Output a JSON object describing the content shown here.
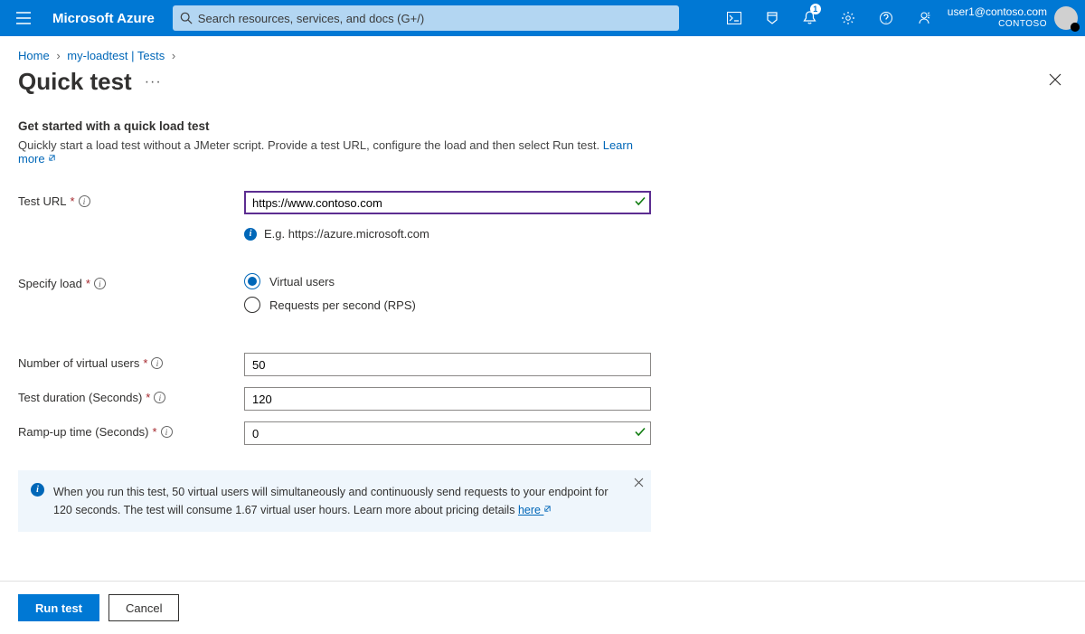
{
  "header": {
    "brand": "Microsoft Azure",
    "search_placeholder": "Search resources, services, and docs (G+/)",
    "notification_count": "1",
    "user_email": "user1@contoso.com",
    "user_tenant": "CONTOSO"
  },
  "breadcrumbs": {
    "home": "Home",
    "resource": "my-loadtest",
    "section": "Tests"
  },
  "page": {
    "title": "Quick test",
    "section_heading": "Get started with a quick load test",
    "section_desc": "Quickly start a load test without a JMeter script. Provide a test URL, configure the load and then select Run test. ",
    "learn_more": "Learn more"
  },
  "form": {
    "test_url_label": "Test URL",
    "test_url_value": "https://www.contoso.com",
    "test_url_hint": "E.g. https://azure.microsoft.com",
    "specify_load_label": "Specify load",
    "radio_virtual_users": "Virtual users",
    "radio_rps": "Requests per second (RPS)",
    "num_users_label": "Number of virtual users",
    "num_users_value": "50",
    "duration_label": "Test duration (Seconds)",
    "duration_value": "120",
    "rampup_label": "Ramp-up time (Seconds)",
    "rampup_value": "0"
  },
  "banner": {
    "text_before": "When you run this test, 50 virtual users will simultaneously and continuously send requests to your endpoint for 120 seconds. The test will consume 1.67 virtual user hours. Learn more about pricing details ",
    "link": "here"
  },
  "footer": {
    "primary": "Run test",
    "secondary": "Cancel"
  }
}
